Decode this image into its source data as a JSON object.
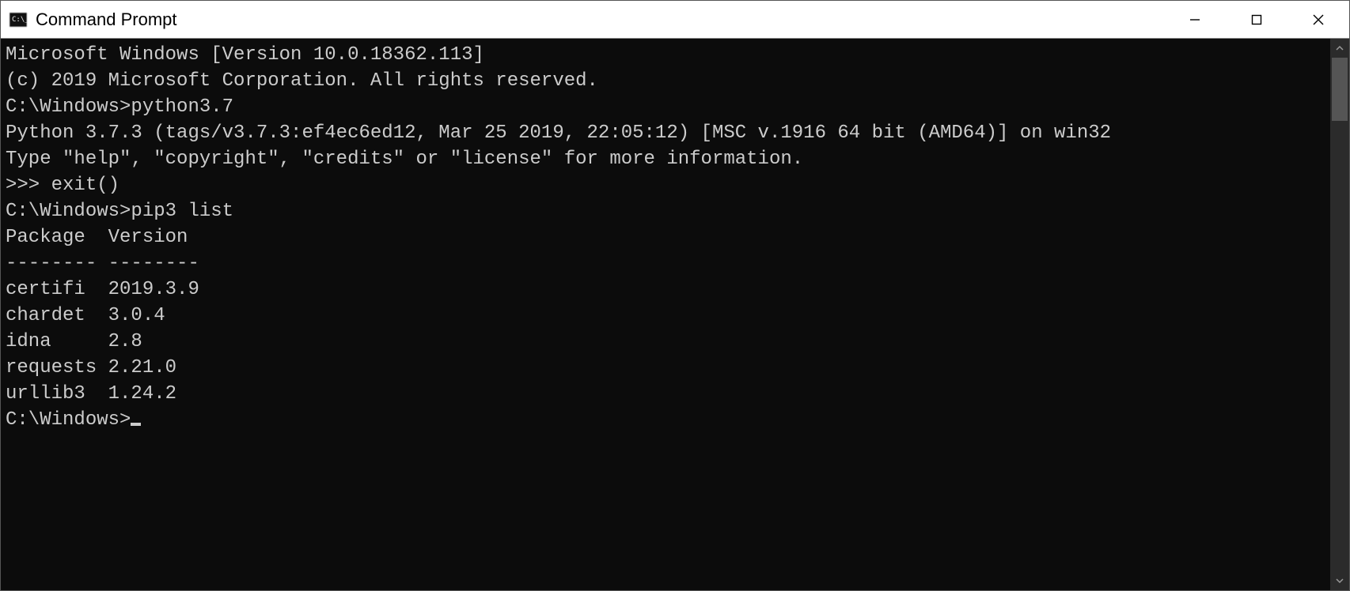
{
  "window": {
    "title": "Command Prompt"
  },
  "terminal": {
    "lines": [
      "Microsoft Windows [Version 10.0.18362.113]",
      "(c) 2019 Microsoft Corporation. All rights reserved.",
      "",
      "C:\\Windows>python3.7",
      "Python 3.7.3 (tags/v3.7.3:ef4ec6ed12, Mar 25 2019, 22:05:12) [MSC v.1916 64 bit (AMD64)] on win32",
      "Type \"help\", \"copyright\", \"credits\" or \"license\" for more information.",
      ">>> exit()",
      "",
      "C:\\Windows>pip3 list",
      "Package  Version",
      "-------- --------",
      "certifi  2019.3.9",
      "chardet  3.0.4",
      "idna     2.8",
      "requests 2.21.0",
      "urllib3  1.24.2",
      "",
      "C:\\Windows>"
    ],
    "prompt_cursor_on_last": true
  },
  "pip_list": {
    "columns": [
      "Package",
      "Version"
    ],
    "rows": [
      {
        "package": "certifi",
        "version": "2019.3.9"
      },
      {
        "package": "chardet",
        "version": "3.0.4"
      },
      {
        "package": "idna",
        "version": "2.8"
      },
      {
        "package": "requests",
        "version": "2.21.0"
      },
      {
        "package": "urllib3",
        "version": "1.24.2"
      }
    ]
  },
  "icons": {
    "app": "cmd-icon",
    "minimize": "minimize-icon",
    "maximize": "maximize-icon",
    "close": "close-icon",
    "scroll_up": "chevron-up-icon",
    "scroll_down": "chevron-down-icon"
  }
}
